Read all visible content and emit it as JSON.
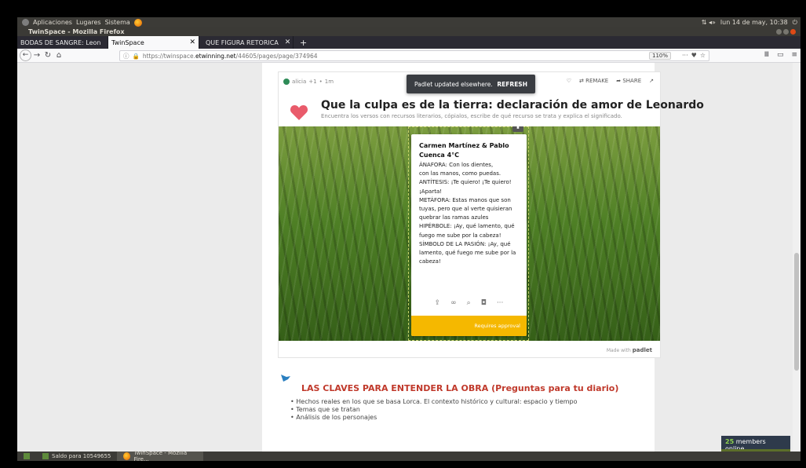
{
  "top_panel": {
    "menus": [
      "Aplicaciones",
      "Lugares",
      "Sistema"
    ],
    "clock": "lun 14 de may, 10:38",
    "status_extra": "⇅ ◂»"
  },
  "window": {
    "title": "TwinSpace - Mozilla Firefox"
  },
  "tabs": [
    {
      "label": "BODAS DE SANGRE: Leon",
      "active": false
    },
    {
      "label": "TwinSpace",
      "active": true
    },
    {
      "label": "QUE FIGURA RETORICA",
      "active": false
    }
  ],
  "nav": {
    "url_prefix": "https://twinspace.",
    "url_host": "etwinning.net",
    "url_path": "/44605/pages/page/374964",
    "zoom": "110%"
  },
  "padlet": {
    "author": "alicia",
    "likes": "+1",
    "time": "1m",
    "toast_text": "Padlet updated elsewhere.",
    "toast_action": "REFRESH",
    "remake": "REMAKE",
    "share": "SHARE",
    "title": "Que la culpa es de la tierra: declaración de amor de Leonardo",
    "subtitle": "Encuentra los versos con recursos literarios, cópialos, escribe de qué recurso se trata y explica el significado.",
    "made_with": "Made with",
    "brand": "padlet",
    "post": {
      "author": "Carmen Martínez & Pablo Cuenca 4°C",
      "lines": [
        "ÁNAFORA: Con los dientes,",
        " con las manos, como puedas.",
        "ANTÍTESIS: ¡Te quiero! ¡Te quiero!",
        "¡Aparta!",
        "METÁFORA: Estas manos que son",
        "tuyas, pero que al verte quisieran",
        "quebrar las ramas azules",
        "HIPÉRBOLE: ¡Ay, qué lamento, qué",
        "fuego me sube por la cabeza!",
        "SÍMBOLO DE LA PASIÓN: ¡Ay, qué",
        "lamento, qué fuego me sube por la",
        "cabeza!"
      ],
      "footer": "Requires approval"
    }
  },
  "section": {
    "title": "LAS CLAVES PARA ENTENDER LA OBRA (Preguntas para tu diario)",
    "bullets": [
      "Hechos reales en los que se basa Lorca. El contexto histórico y cultural: espacio y tiempo",
      "Temas que se tratan",
      "Análisis de los personajes"
    ]
  },
  "members": {
    "count": "25",
    "label": "members online"
  },
  "taskbar": [
    {
      "label": "Saldo para 10549655",
      "active": false
    },
    {
      "label": "TwinSpace - Mozilla Fire...",
      "active": true
    }
  ],
  "colors": {
    "accent_red": "#c0392b",
    "post_footer": "#f5b800",
    "heart": "#e95b6b"
  }
}
